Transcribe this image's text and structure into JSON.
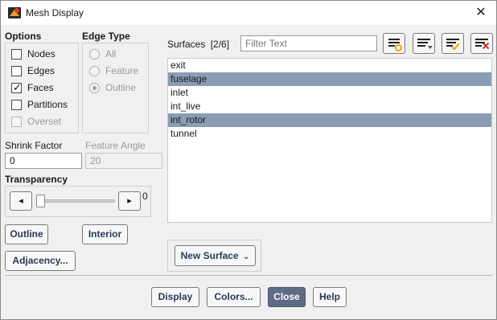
{
  "window": {
    "title": "Mesh Display",
    "close_label": "✕"
  },
  "options": {
    "label": "Options",
    "items": [
      {
        "label": "Nodes",
        "checked": false,
        "disabled": false
      },
      {
        "label": "Edges",
        "checked": false,
        "disabled": false
      },
      {
        "label": "Faces",
        "checked": true,
        "disabled": false
      },
      {
        "label": "Partitions",
        "checked": false,
        "disabled": false
      },
      {
        "label": "Overset",
        "checked": false,
        "disabled": true
      }
    ]
  },
  "edge_type": {
    "label": "Edge Type",
    "items": [
      {
        "label": "All",
        "selected": false
      },
      {
        "label": "Feature",
        "selected": false
      },
      {
        "label": "Outline",
        "selected": true
      }
    ]
  },
  "shrink_factor": {
    "label": "Shrink Factor",
    "value": "0"
  },
  "feature_angle": {
    "label": "Feature Angle",
    "value": "20"
  },
  "transparency": {
    "label": "Transparency",
    "value": "0",
    "fraction": 0,
    "left_glyph": "◂",
    "right_glyph": "▸"
  },
  "buttons": {
    "outline": "Outline",
    "interior": "Interior",
    "adjacency": "Adjacency...",
    "new_surface": "New Surface",
    "new_surface_caret": "⌄"
  },
  "surfaces": {
    "label": "Surfaces",
    "count": "[2/6]",
    "filter_placeholder": "Filter Text",
    "items": [
      {
        "name": "exit",
        "selected": false
      },
      {
        "name": "fuselage",
        "selected": true
      },
      {
        "name": "inlet",
        "selected": false
      },
      {
        "name": "int_live",
        "selected": false
      },
      {
        "name": "int_rotor",
        "selected": true
      },
      {
        "name": "tunnel",
        "selected": false
      }
    ]
  },
  "footer": {
    "display": "Display",
    "colors": "Colors...",
    "close": "Close",
    "help": "Help"
  },
  "colors": {
    "selection": "#8a9db4",
    "primary_button": "#5d6b85",
    "accent_yellow": "#e0a800",
    "accent_red": "#c0392b"
  }
}
